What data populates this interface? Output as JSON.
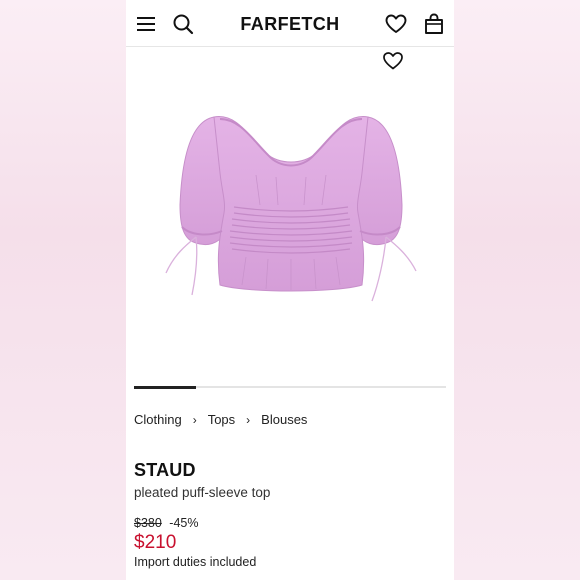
{
  "header": {
    "logo": "FARFETCH",
    "icons": [
      "hamburger-menu-icon",
      "search-icon",
      "heart-icon",
      "shopping-bag-icon"
    ]
  },
  "product_image": {
    "favorite_icon": "heart-icon",
    "color": "#dba6dc",
    "carousel": {
      "active_index": 1,
      "total_fraction_shown": 0.2
    }
  },
  "breadcrumb": {
    "items": [
      "Clothing",
      "Tops",
      "Blouses"
    ],
    "separator": "›"
  },
  "product": {
    "brand": "STAUD",
    "name": "pleated puff-sleeve top",
    "original_price": "$380",
    "discount": "-45%",
    "sale_price": "$210",
    "duties_note": "Import duties included"
  },
  "colors": {
    "sale": "#c8102e",
    "text": "#111111"
  }
}
